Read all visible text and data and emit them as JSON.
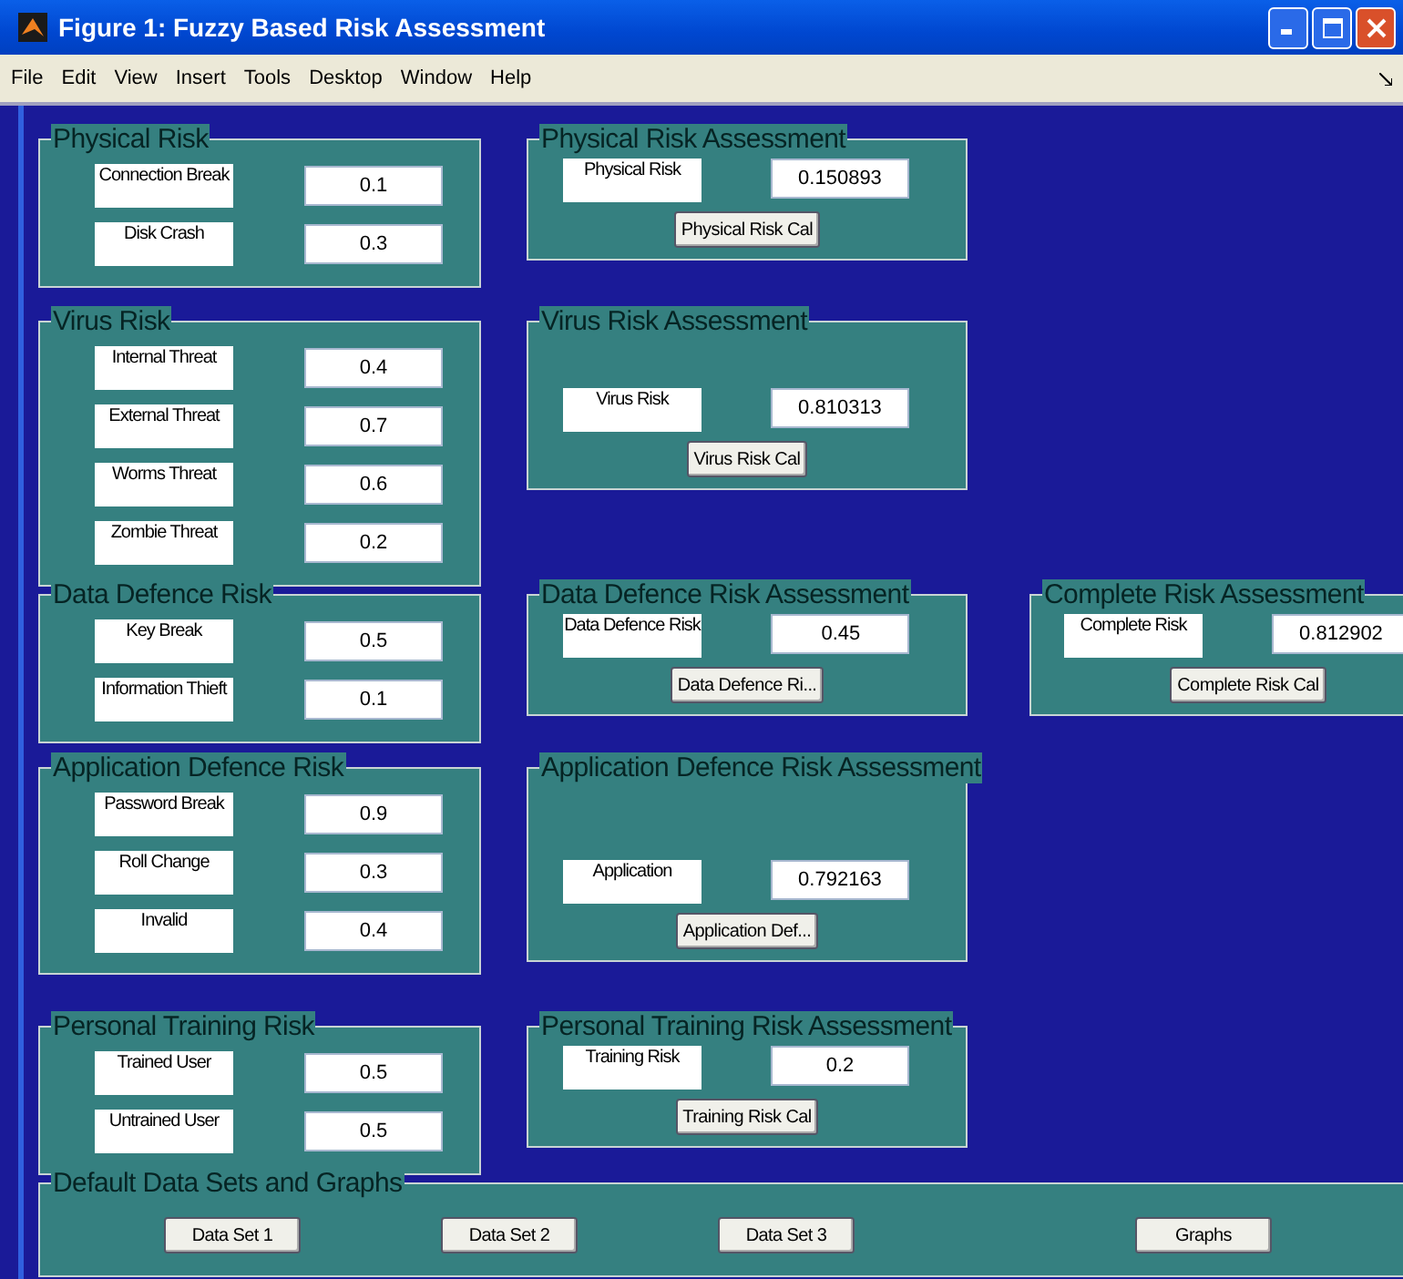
{
  "window": {
    "title": "Figure 1: Fuzzy Based Risk Assessment"
  },
  "menu": [
    "File",
    "Edit",
    "View",
    "Insert",
    "Tools",
    "Desktop",
    "Window",
    "Help"
  ],
  "rows": [
    {
      "input": {
        "title": "Physical Risk",
        "fields": [
          {
            "label": "Connection Break",
            "value": "0.1"
          },
          {
            "label": "Disk Crash",
            "value": "0.3"
          }
        ]
      },
      "assessment": {
        "title": "Physical Risk Assessment",
        "label": "Physical Risk",
        "value": "0.150893",
        "button": "Physical Risk Cal"
      }
    },
    {
      "input": {
        "title": "Virus Risk",
        "fields": [
          {
            "label": "Internal Threat",
            "value": "0.4"
          },
          {
            "label": "External Threat",
            "value": "0.7"
          },
          {
            "label": "Worms Threat",
            "value": "0.6"
          },
          {
            "label": "Zombie Threat",
            "value": "0.2"
          }
        ]
      },
      "assessment": {
        "title": "Virus Risk Assessment",
        "label": "Virus Risk",
        "value": "0.810313",
        "button": "Virus Risk Cal"
      }
    },
    {
      "input": {
        "title": "Data Defence Risk",
        "fields": [
          {
            "label": "Key Break",
            "value": "0.5"
          },
          {
            "label": "Information Thieft",
            "value": "0.1"
          }
        ]
      },
      "assessment": {
        "title": "Data Defence Risk Assessment",
        "label": "Data Defence Risk",
        "value": "0.45",
        "button": "Data Defence Ri..."
      },
      "summary": {
        "title": "Complete Risk Assessment",
        "label": "Complete Risk",
        "value": "0.812902",
        "button": "Complete Risk Cal"
      }
    },
    {
      "input": {
        "title": "Application Defence Risk",
        "fields": [
          {
            "label": "Password Break",
            "value": "0.9"
          },
          {
            "label": "Roll Change",
            "value": "0.3"
          },
          {
            "label": "Invalid",
            "value": "0.4"
          }
        ]
      },
      "assessment": {
        "title": "Application Defence Risk Assessment",
        "label": "Application",
        "value": "0.792163",
        "button": "Application Def..."
      }
    },
    {
      "input": {
        "title": "Personal Training Risk",
        "fields": [
          {
            "label": "Trained User",
            "value": "0.5"
          },
          {
            "label": "Untrained User",
            "value": "0.5"
          }
        ]
      },
      "assessment": {
        "title": "Personal Training Risk Assessment",
        "label": "Training Risk",
        "value": "0.2",
        "button": "Training  Risk Cal"
      }
    }
  ],
  "defaults": {
    "title": "Default Data Sets and Graphs",
    "buttons": [
      "Data Set 1",
      "Data Set 2",
      "Data Set 3",
      "Graphs"
    ]
  }
}
